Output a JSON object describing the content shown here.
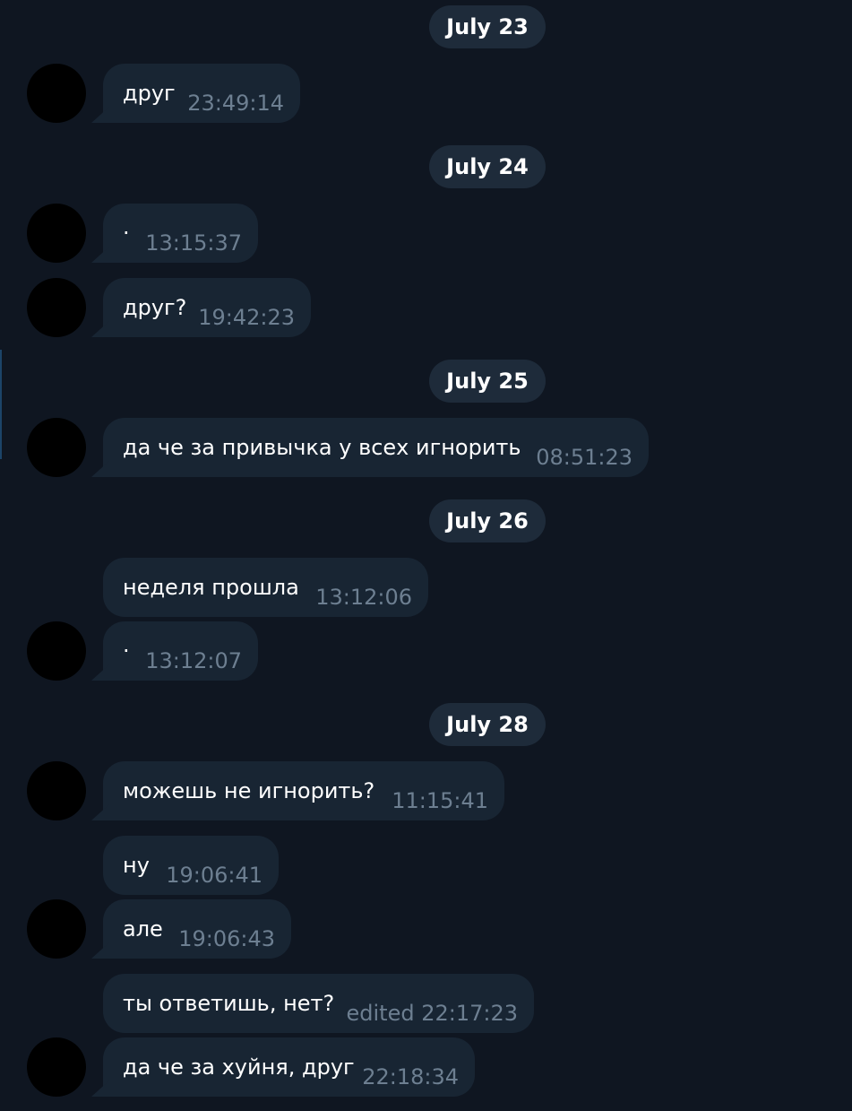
{
  "dates": [
    "July 23",
    "July 24",
    "July 25",
    "July 26",
    "July 28"
  ],
  "messages": [
    {
      "text": "друг",
      "time": "23:49:14"
    },
    {
      "text": "·",
      "time": "13:15:37"
    },
    {
      "text": "друг?",
      "time": "19:42:23"
    },
    {
      "text": "да че за привычка у всех игнорить",
      "time": "08:51:23"
    },
    {
      "text": "неделя прошла",
      "time": "13:12:06"
    },
    {
      "text": "·",
      "time": "13:12:07"
    },
    {
      "text": "можешь не игнорить?",
      "time": "11:15:41"
    },
    {
      "text": "ну",
      "time": "19:06:41"
    },
    {
      "text": "але",
      "time": "19:06:43"
    },
    {
      "text": "ты ответишь, нет?",
      "time": "edited 22:17:23"
    },
    {
      "text": "да че за хуйня, друг",
      "time": "22:18:34"
    }
  ]
}
